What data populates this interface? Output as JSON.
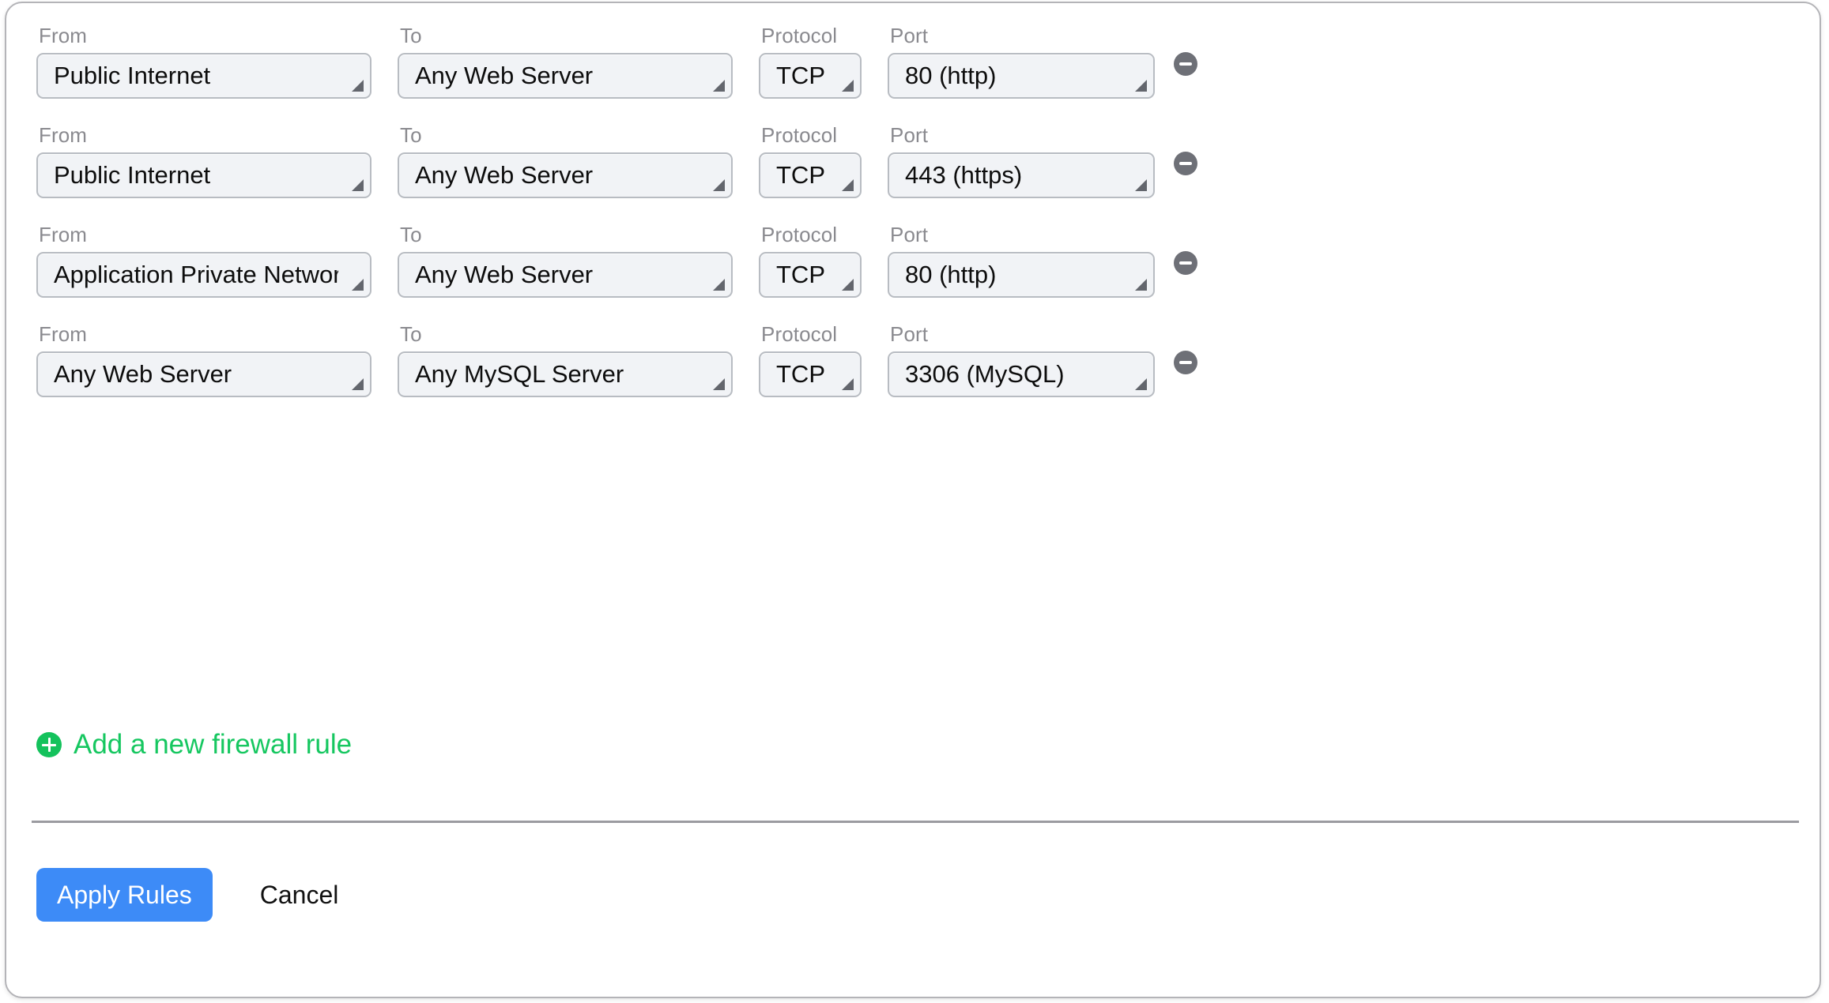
{
  "panel": {
    "columns": {
      "from_label": "From",
      "to_label": "To",
      "protocol_label": "Protocol",
      "port_label": "Port"
    },
    "rules": [
      {
        "from": "Public Internet",
        "to": "Any Web Server",
        "protocol": "TCP",
        "port": "80 (http)",
        "remove_icon": "minus-circle-icon"
      },
      {
        "from": "Public Internet",
        "to": "Any Web Server",
        "protocol": "TCP",
        "port": "443 (https)",
        "remove_icon": "minus-circle-icon"
      },
      {
        "from": "Application Private Network",
        "to": "Any Web Server",
        "protocol": "TCP",
        "port": "80 (http)",
        "remove_icon": "minus-circle-icon"
      },
      {
        "from": "Any Web Server",
        "to": "Any MySQL Server",
        "protocol": "TCP",
        "port": "3306 (MySQL)",
        "remove_icon": "minus-circle-icon"
      }
    ],
    "add_rule": {
      "label": "Add a new firewall rule",
      "icon": "plus-circle-icon",
      "color": "#16c760"
    },
    "footer": {
      "apply_label": "Apply Rules",
      "cancel_label": "Cancel",
      "apply_color": "#3d8bf7"
    },
    "colors": {
      "accent_blue": "#3d8bf7",
      "accent_green": "#16c760",
      "field_bg": "#f1f3f6",
      "field_border": "#b8bcc2",
      "label_text": "#8a8a8f",
      "remove_gray": "#6e7077"
    }
  }
}
